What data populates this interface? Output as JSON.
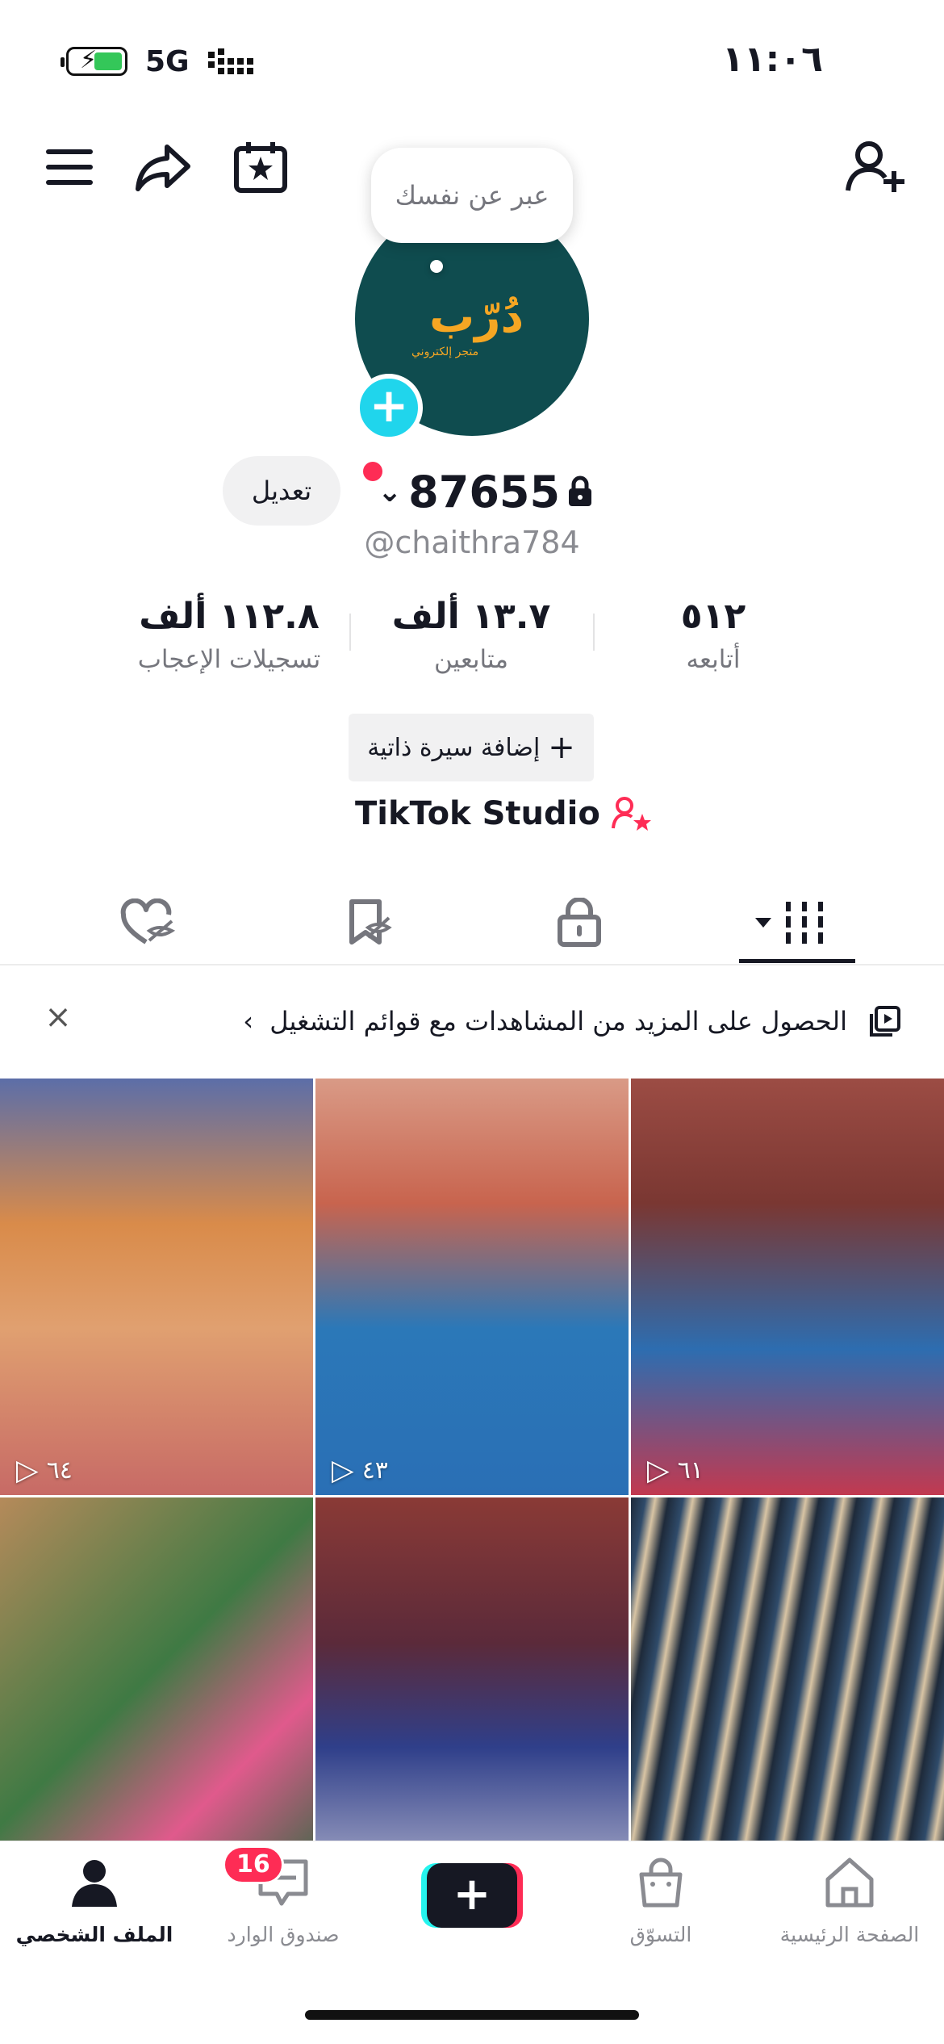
{
  "status_bar": {
    "time": "١١:٠٦",
    "network": "5G"
  },
  "avatar_bubble": {
    "text": "عبر عن نفسك"
  },
  "avatar_logo": {
    "text": "دُرّب",
    "sub": "متجر إلكتروني"
  },
  "profile": {
    "edit_label": "تعديل",
    "username": "87655",
    "handle": "@chaithra784"
  },
  "stats": [
    {
      "value": "١١٢.٨ ألف",
      "label": "تسجيلات الإعجاب"
    },
    {
      "value": "١٣.٧ ألف",
      "label": "متابعين"
    },
    {
      "value": "٥١٢",
      "label": "أتابعه"
    }
  ],
  "bio_button": {
    "label": "إضافة سيرة ذاتية",
    "plus": "+"
  },
  "studio_link": {
    "label": "TikTok Studio"
  },
  "banner": {
    "text": "الحصول على المزيد من المشاهدات مع قوائم التشغيل",
    "chevron": "‹",
    "close": "×"
  },
  "videos": [
    {
      "views": "٦٤"
    },
    {
      "views": "٤٣"
    },
    {
      "views": "٦١"
    },
    {
      "views": ""
    },
    {
      "views": ""
    },
    {
      "views": ""
    }
  ],
  "bottom_nav": {
    "profile": "الملف الشخصي",
    "inbox": "صندوق الوارد",
    "inbox_badge": "16",
    "create": "+",
    "shop": "التسوّق",
    "home": "الصفحة الرئيسية"
  },
  "colors": {
    "accent": "#fe2c55",
    "cyan": "#25f4ee",
    "avatar_bg": "#0f4c4f"
  }
}
